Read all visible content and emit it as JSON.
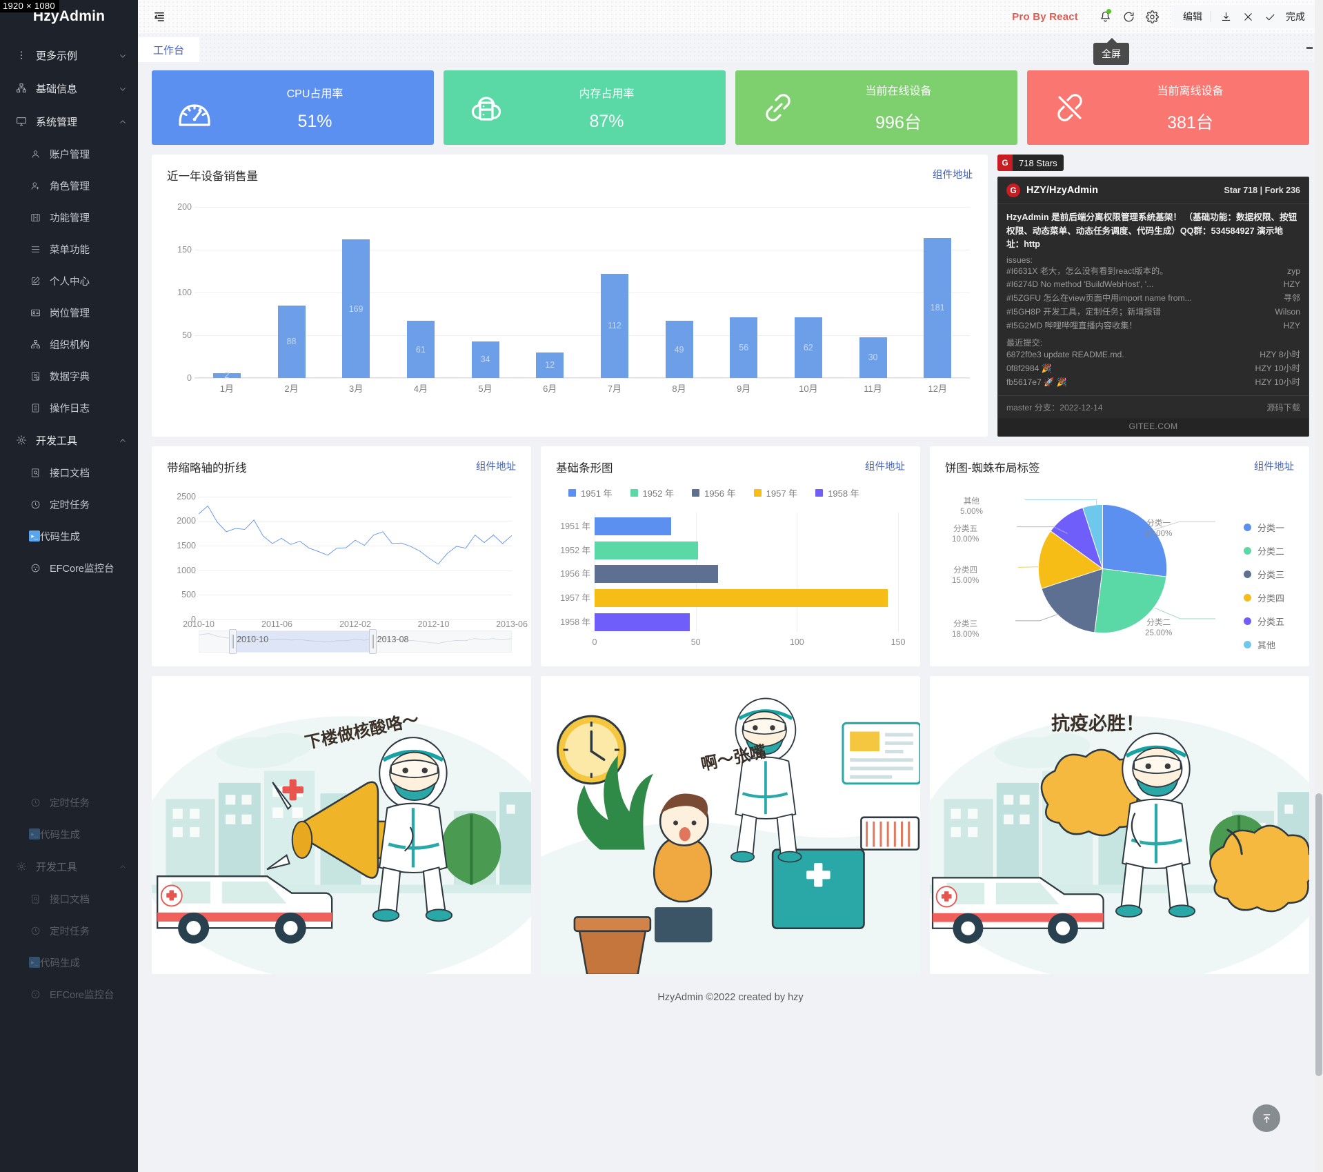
{
  "resolution_badge": "1920 × 1080",
  "brand": {
    "title": "HzyAdmin"
  },
  "sidebar": {
    "items": [
      {
        "label": "更多示例",
        "icon": "dots-vertical-icon",
        "level": 0,
        "caret": "down"
      },
      {
        "label": "基础信息",
        "icon": "cluster-icon",
        "level": 0,
        "caret": "down"
      },
      {
        "label": "系统管理",
        "icon": "desktop-icon",
        "level": 0,
        "caret": "up"
      },
      {
        "label": "账户管理",
        "icon": "user-icon",
        "level": 1
      },
      {
        "label": "角色管理",
        "icon": "user-add-icon",
        "level": 1
      },
      {
        "label": "功能管理",
        "icon": "function-icon",
        "level": 1
      },
      {
        "label": "菜单功能",
        "icon": "menu-lines-icon",
        "level": 1
      },
      {
        "label": "个人中心",
        "icon": "edit-square-icon",
        "level": 1
      },
      {
        "label": "岗位管理",
        "icon": "idcard-icon",
        "level": 1
      },
      {
        "label": "组织机构",
        "icon": "cluster-icon",
        "level": 1
      },
      {
        "label": "数据字典",
        "icon": "book-icon",
        "level": 1
      },
      {
        "label": "操作日志",
        "icon": "file-list-icon",
        "level": 1
      },
      {
        "label": "开发工具",
        "icon": "tool-icon",
        "level": 0,
        "caret": "up"
      },
      {
        "label": "接口文档",
        "icon": "doc-search-icon",
        "level": 1
      },
      {
        "label": "定时任务",
        "icon": "clock-icon",
        "level": 1
      },
      {
        "label": "代码生成",
        "icon": "console-icon",
        "level": 1
      },
      {
        "label": "EFCore监控台",
        "icon": "dashboard-icon",
        "level": 1
      }
    ],
    "ghost_items": [
      {
        "label": "定时任务",
        "icon": "clock-icon",
        "level": 1
      },
      {
        "label": "代码生成",
        "icon": "console-icon",
        "level": 1
      },
      {
        "label": "开发工具",
        "icon": "tool-icon",
        "level": 0,
        "caret": "up"
      },
      {
        "label": "接口文档",
        "icon": "doc-search-icon",
        "level": 1
      },
      {
        "label": "定时任务",
        "icon": "clock-icon",
        "level": 1
      },
      {
        "label": "代码生成",
        "icon": "console-icon",
        "level": 1
      },
      {
        "label": "EFCore监控台",
        "icon": "dashboard-icon",
        "level": 1
      }
    ]
  },
  "topbar": {
    "menu_toggle": "menu-fold-icon",
    "pro_brand": "Pro By React",
    "bell": "bell-icon",
    "refresh": "reload-icon",
    "settings": "gear-icon",
    "edit_label": "编辑",
    "download": "download-icon",
    "close": "close-icon",
    "check": "check-icon",
    "done_label": "完成"
  },
  "tabs": {
    "items": [
      {
        "label": "工作台",
        "active": true
      }
    ],
    "tooltip": "全屏",
    "more_icon": "dots-vertical-icon"
  },
  "stats": [
    {
      "title": "CPU占用率",
      "value": "51%",
      "color": "#5b8ff0",
      "icon": "gauge-icon"
    },
    {
      "title": "内存占用率",
      "value": "87%",
      "color": "#5ad8a6",
      "icon": "cloud-server-icon"
    },
    {
      "title": "当前在线设备",
      "value": "996台",
      "color": "#7ed06e",
      "icon": "link-icon"
    },
    {
      "title": "当前离线设备",
      "value": "381台",
      "color": "#fa7670",
      "icon": "link-broken-icon"
    }
  ],
  "cards": {
    "bar": {
      "title": "近一年设备销售量",
      "link": "组件地址"
    },
    "line": {
      "title": "带缩略轴的折线",
      "link": "组件地址"
    },
    "hbar": {
      "title": "基础条形图",
      "link": "组件地址"
    },
    "pie": {
      "title": "饼图-蜘蛛布局标签",
      "link": "组件地址"
    }
  },
  "gitee": {
    "stars_badge": "718 Stars",
    "badge_mark": "G",
    "repo": "HZY/HzyAdmin",
    "star_fork": "Star 718 | Fork 236",
    "description": "HzyAdmin 是前后端分离权限管理系统基架！ （基础功能：数据权限、按钮权限、动态菜单、动态任务调度、代码生成）QQ群：534584927 演示地址：http",
    "issues_label": "issues:",
    "issues": [
      {
        "text": "#I6631X 老大，怎么没有看到react版本的。",
        "author": "zyp"
      },
      {
        "text": "#I6274D No method 'BuildWebHost', '...",
        "author": "HZY"
      },
      {
        "text": "#I5ZGFU 怎么在view页面中用import name from...",
        "author": "寻邻"
      },
      {
        "text": "#I5GH8P 开发工具，定制任务；新增报错",
        "author": "Wilson"
      },
      {
        "text": "#I5G2MD 哔哩哔哩直播内容收集！",
        "author": "HZY"
      }
    ],
    "commits_label": "最近提交:",
    "commits": [
      {
        "text": "6872f0e3 update README.md.",
        "author": "HZY 8小时"
      },
      {
        "text": "0f8f2984 🎉",
        "author": "HZY 10小时"
      },
      {
        "text": "fb5617e7 🚀 🎉",
        "author": "HZY 10小时"
      }
    ],
    "branch": "master 分支：2022-12-14",
    "download": "源码下载",
    "site": "GITEE.COM"
  },
  "illustrations": [
    {
      "caption": "下楼做核酸咯～",
      "name": "nucleic-acid-announcement"
    },
    {
      "caption": "啊～张嘴",
      "name": "nucleic-acid-test"
    },
    {
      "caption": "抗疫必胜！",
      "name": "fight-epidemic-victory"
    }
  ],
  "footer": {
    "text": "HzyAdmin ©2022 created by hzy"
  },
  "back_to_top": {
    "icon": "to-top-icon"
  },
  "chart_data": [
    {
      "type": "bar",
      "title": "近一年设备销售量",
      "categories": [
        "1月",
        "2月",
        "3月",
        "4月",
        "5月",
        "6月",
        "7月",
        "8月",
        "9月",
        "10月",
        "11月",
        "12月"
      ],
      "values": [
        2,
        88,
        169,
        61,
        34,
        12,
        112,
        49,
        56,
        62,
        30,
        181
      ],
      "bar_pixel_values": [
        6,
        85,
        162,
        67,
        43,
        30,
        122,
        67,
        71,
        71,
        48,
        164
      ],
      "labels": [
        "2",
        "88",
        "169",
        "61",
        "34",
        "12",
        "112",
        "49",
        "56",
        "62",
        "30",
        "181"
      ],
      "yticks": [
        0,
        50,
        100,
        150,
        200
      ],
      "ylim": [
        0,
        210
      ],
      "xlabel": "",
      "ylabel": "",
      "grid": true,
      "color": "#6d9fe8"
    },
    {
      "type": "line",
      "title": "带缩略轴的折线",
      "x": [
        "2010-10",
        "2011-06",
        "2012-02",
        "2012-10",
        "2013-06"
      ],
      "xticks": [
        "2010-10",
        "2011-06",
        "2012-02",
        "2012-10",
        "2013-06"
      ],
      "yticks": [
        0,
        500,
        1000,
        1500,
        2000,
        2500
      ],
      "ylim": [
        0,
        2600
      ],
      "values": [
        2130,
        2300,
        1960,
        1750,
        1820,
        1800,
        2000,
        1660,
        1500,
        1610,
        1480,
        1550,
        1400,
        1330,
        1250,
        1400,
        1410,
        1570,
        1460,
        1680,
        1750,
        1500,
        1510,
        1440,
        1340,
        1190,
        1060,
        1290,
        1440,
        1400,
        1680,
        1520,
        1680,
        1500,
        1670
      ],
      "brush": {
        "start_label": "2010-10",
        "end_label": "2013-08"
      },
      "color": "#5b8ff0",
      "grid": true
    },
    {
      "type": "bar",
      "orientation": "horizontal",
      "title": "基础条形图",
      "categories": [
        "1951 年",
        "1952 年",
        "1956 年",
        "1957 年",
        "1958 年"
      ],
      "values": [
        38,
        51,
        61,
        145,
        47
      ],
      "colors": [
        "#5b8ff0",
        "#5ad8a6",
        "#5d7092",
        "#f6bd16",
        "#6f5ef9"
      ],
      "legend": [
        "1951 年",
        "1952 年",
        "1956 年",
        "1957 年",
        "1958 年"
      ],
      "legend_position": "top",
      "xticks": [
        0,
        50,
        100,
        150
      ],
      "xlim": [
        0,
        150
      ],
      "grid": true
    },
    {
      "type": "pie",
      "title": "饼图-蜘蛛布局标签",
      "labels": [
        "分类一",
        "分类二",
        "分类三",
        "分类四",
        "分类五",
        "其他"
      ],
      "values": [
        27,
        25,
        18,
        15,
        10,
        5
      ],
      "value_labels": [
        "27.00%",
        "25.00%",
        "18.00%",
        "15.00%",
        "10.00%",
        "5.00%"
      ],
      "colors": [
        "#5b8ff0",
        "#5ad8a6",
        "#5d7092",
        "#f6bd16",
        "#6f5ef9",
        "#6dc8ec"
      ],
      "legend": [
        "分类一",
        "分类二",
        "分类三",
        "分类四",
        "分类五",
        "其他"
      ],
      "legend_position": "right"
    }
  ]
}
